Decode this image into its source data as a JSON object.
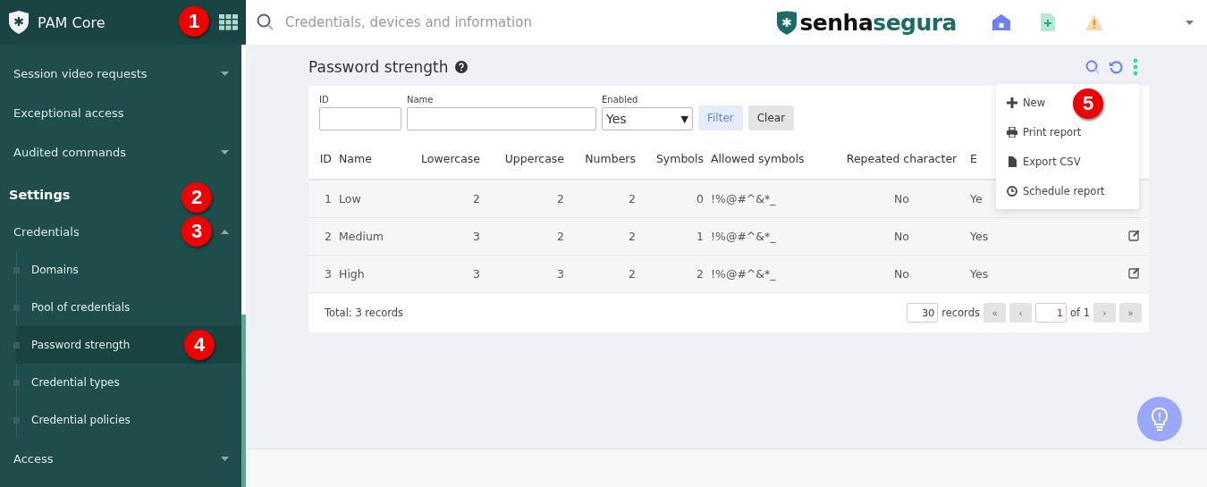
{
  "sidebar": {
    "title": "PAM Core",
    "items": [
      {
        "kind": "group",
        "label": "Session video requests",
        "expanded": false
      },
      {
        "kind": "link",
        "label": "Exceptional access"
      },
      {
        "kind": "group",
        "label": "Audited commands",
        "expanded": false
      },
      {
        "kind": "heading",
        "label": "Settings"
      },
      {
        "kind": "group",
        "label": "Credentials",
        "expanded": true,
        "children": [
          {
            "label": "Domains",
            "selected": false
          },
          {
            "label": "Pool of credentials",
            "selected": false
          },
          {
            "label": "Password strength",
            "selected": true
          },
          {
            "label": "Credential types",
            "selected": false
          },
          {
            "label": "Credential policies",
            "selected": false
          }
        ]
      },
      {
        "kind": "group",
        "label": "Access",
        "expanded": false
      }
    ]
  },
  "topbar": {
    "search": {
      "placeholder": "Credentials, devices and information"
    },
    "logo": {
      "part_1": "senha",
      "part_2": "segura"
    }
  },
  "page": {
    "title": "Password strength",
    "filters": {
      "id": {
        "label": "ID"
      },
      "name": {
        "label": "Name"
      },
      "enabled": {
        "label": "Enabled",
        "value": "Yes",
        "arrow": "▼"
      },
      "buttons": [
        "Filter",
        "Clear"
      ]
    },
    "table": {
      "columns": [
        "ID",
        "Name",
        "Lowercase",
        "Uppercase",
        "Numbers",
        "Symbols",
        "Allowed symbols",
        "Repeated character",
        "E"
      ],
      "rows": [
        {
          "cells": [
            "1",
            "Low",
            "2",
            "2",
            "2",
            "0",
            "!%@#^&*_",
            "No",
            "Ye"
          ]
        },
        {
          "cells": [
            "2",
            "Medium",
            "3",
            "2",
            "2",
            "1",
            "!%@#^&*_",
            "No",
            "Yes"
          ],
          "editable": true
        },
        {
          "cells": [
            "3",
            "High",
            "3",
            "3",
            "2",
            "2",
            "!%@#^&*_",
            "No",
            "Yes"
          ],
          "editable": true
        }
      ]
    },
    "footer": {
      "total": "Total: 3 records",
      "per_page": "30",
      "records_label": "records",
      "first": "«",
      "prev": "‹",
      "page": "1",
      "of": "of 1",
      "next": "›",
      "last": "»"
    },
    "menu": [
      {
        "kind": "plus",
        "label": "New"
      },
      {
        "kind": "print",
        "label": "Print report"
      },
      {
        "kind": "file",
        "label": "Export CSV"
      },
      {
        "kind": "clock",
        "label": "Schedule report"
      }
    ]
  },
  "callouts": [
    "1",
    "2",
    "3",
    "4",
    "5"
  ]
}
